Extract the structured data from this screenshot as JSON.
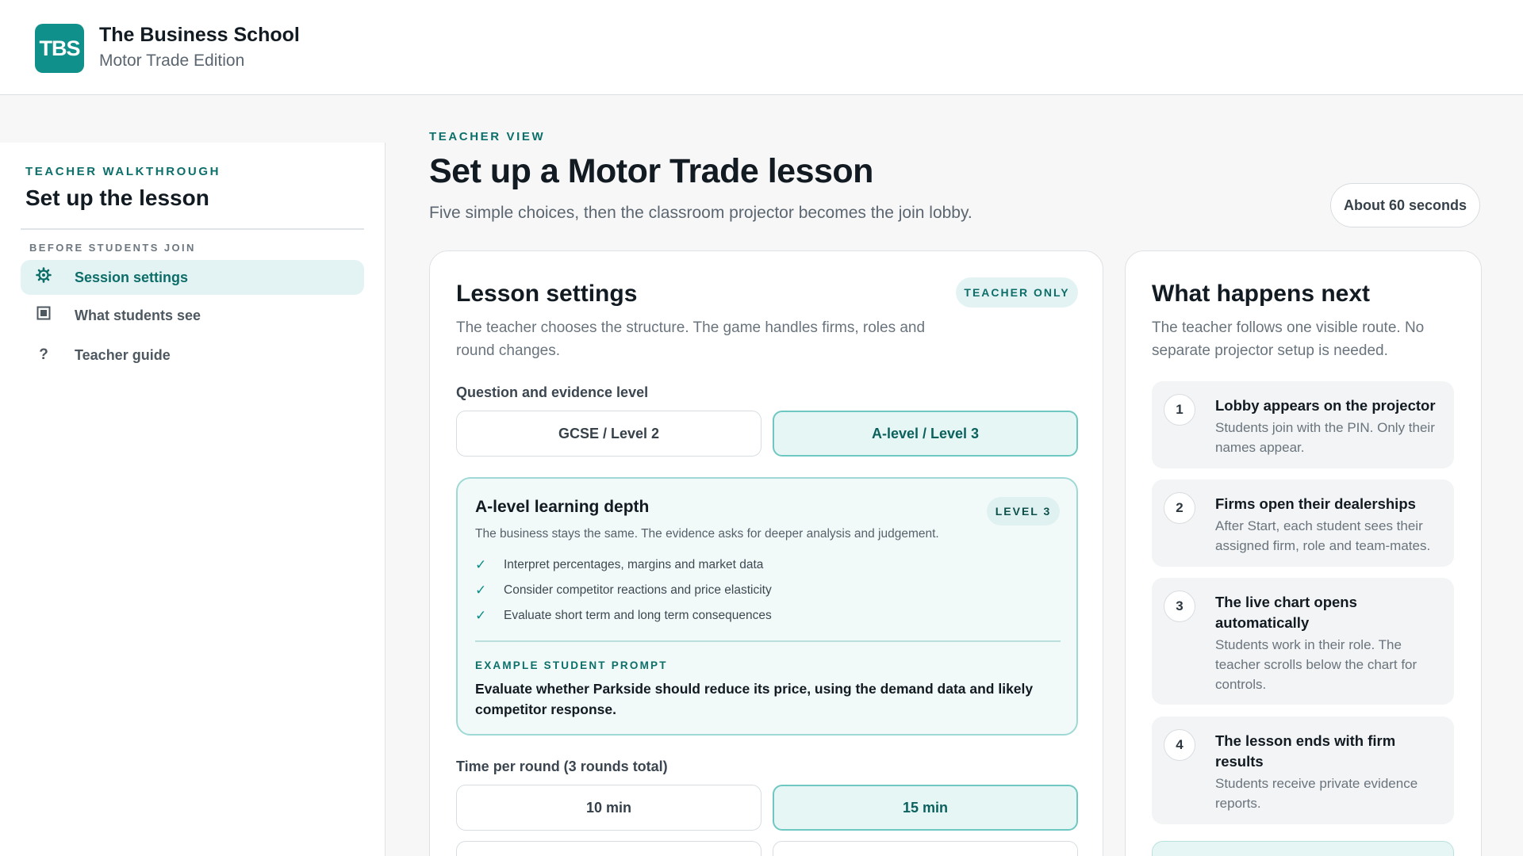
{
  "brand": {
    "logo_text": "TBS",
    "title": "The Business School",
    "subtitle": "Motor Trade Edition"
  },
  "sidebar": {
    "kicker": "TEACHER WALKTHROUGH",
    "title": "Set up the lesson",
    "group_label": "BEFORE STUDENTS JOIN",
    "items": [
      {
        "label": "Session settings",
        "icon": "gear-icon",
        "active": true
      },
      {
        "label": "What students see",
        "icon": "screen-icon",
        "active": false
      },
      {
        "label": "Teacher guide",
        "icon": "question-icon",
        "active": false
      }
    ]
  },
  "main": {
    "kicker": "TEACHER VIEW",
    "title": "Set up a Motor Trade lesson",
    "subtitle": "Five simple choices, then the classroom projector becomes the join lobby.",
    "time_pill": "About 60 seconds"
  },
  "settings": {
    "title": "Lesson settings",
    "badge": "TEACHER ONLY",
    "description": "The teacher chooses the structure. The game handles firms, roles and round changes.",
    "level_label": "Question and evidence level",
    "level_options": [
      {
        "label": "GCSE / Level 2",
        "selected": false
      },
      {
        "label": "A-level / Level 3",
        "selected": true
      }
    ],
    "depth": {
      "title": "A-level learning depth",
      "badge": "LEVEL 3",
      "description": "The business stays the same. The evidence asks for deeper analysis and judgement.",
      "checks": [
        "Interpret percentages, margins and market data",
        "Consider competitor reactions and price elasticity",
        "Evaluate short term and long term consequences"
      ],
      "example_label": "EXAMPLE STUDENT PROMPT",
      "example_text": "Evaluate whether Parkside should reduce its price, using the demand data and likely competitor response."
    },
    "time_label": "Time per round (3 rounds total)",
    "time_options": [
      {
        "label": "10 min",
        "selected": false
      },
      {
        "label": "15 min",
        "selected": true
      }
    ]
  },
  "next": {
    "title": "What happens next",
    "description": "The teacher follows one visible route. No separate projector setup is needed.",
    "steps": [
      {
        "num": "1",
        "title": "Lobby appears on the projector",
        "desc": "Students join with the PIN. Only their names appear."
      },
      {
        "num": "2",
        "title": "Firms open their dealerships",
        "desc": "After Start, each student sees their assigned firm, role and team-mates."
      },
      {
        "num": "3",
        "title": "The live chart opens automatically",
        "desc": "Students work in their role. The teacher scrolls below the chart for controls."
      },
      {
        "num": "4",
        "title": "The lesson ends with firm results",
        "desc": "Students receive private evidence reports."
      }
    ]
  },
  "colors": {
    "accent": "#10908b",
    "accent_dark": "#0c6f6a",
    "selected_bg": "#e6f6f5",
    "selected_border": "#6fc7c2"
  }
}
